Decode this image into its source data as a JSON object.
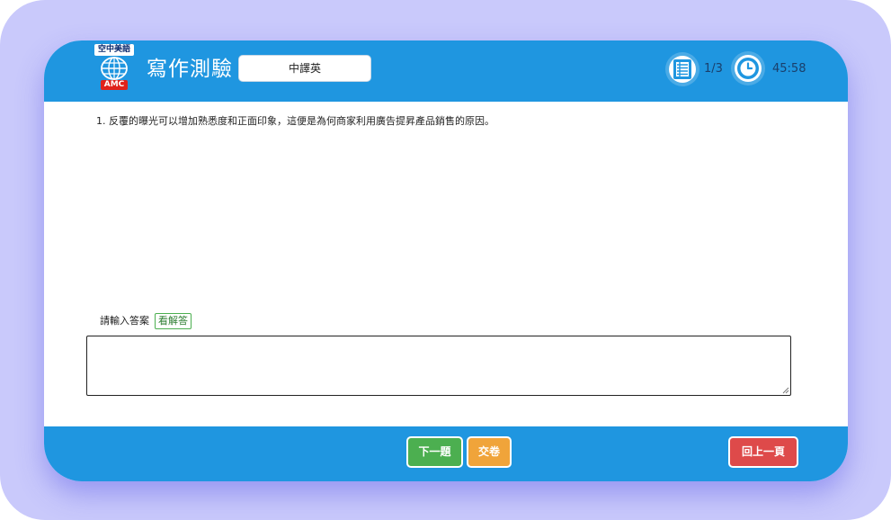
{
  "header": {
    "logo_top": "空中美語",
    "logo_brand": "AMC",
    "title": "寫作測驗",
    "mode_value": "中譯英",
    "progress": "1/3",
    "timer": "45:58",
    "list_icon": "list-icon",
    "clock_icon": "clock-icon"
  },
  "question": {
    "text": "1. 反覆的曝光可以增加熟悉度和正面印象，這便是為何商家利用廣告提昇產品銷售的原因。"
  },
  "answer": {
    "label": "請輸入答案",
    "show_answer_label": "看解答",
    "value": "",
    "placeholder": ""
  },
  "footer": {
    "next_label": "下一題",
    "submit_label": "交卷",
    "back_label": "回上一頁"
  },
  "colors": {
    "accent": "#1f96e0",
    "outer_bg": "#c9c9fb",
    "next": "#4caf50",
    "submit": "#f0a43a",
    "back": "#de4a4a"
  }
}
